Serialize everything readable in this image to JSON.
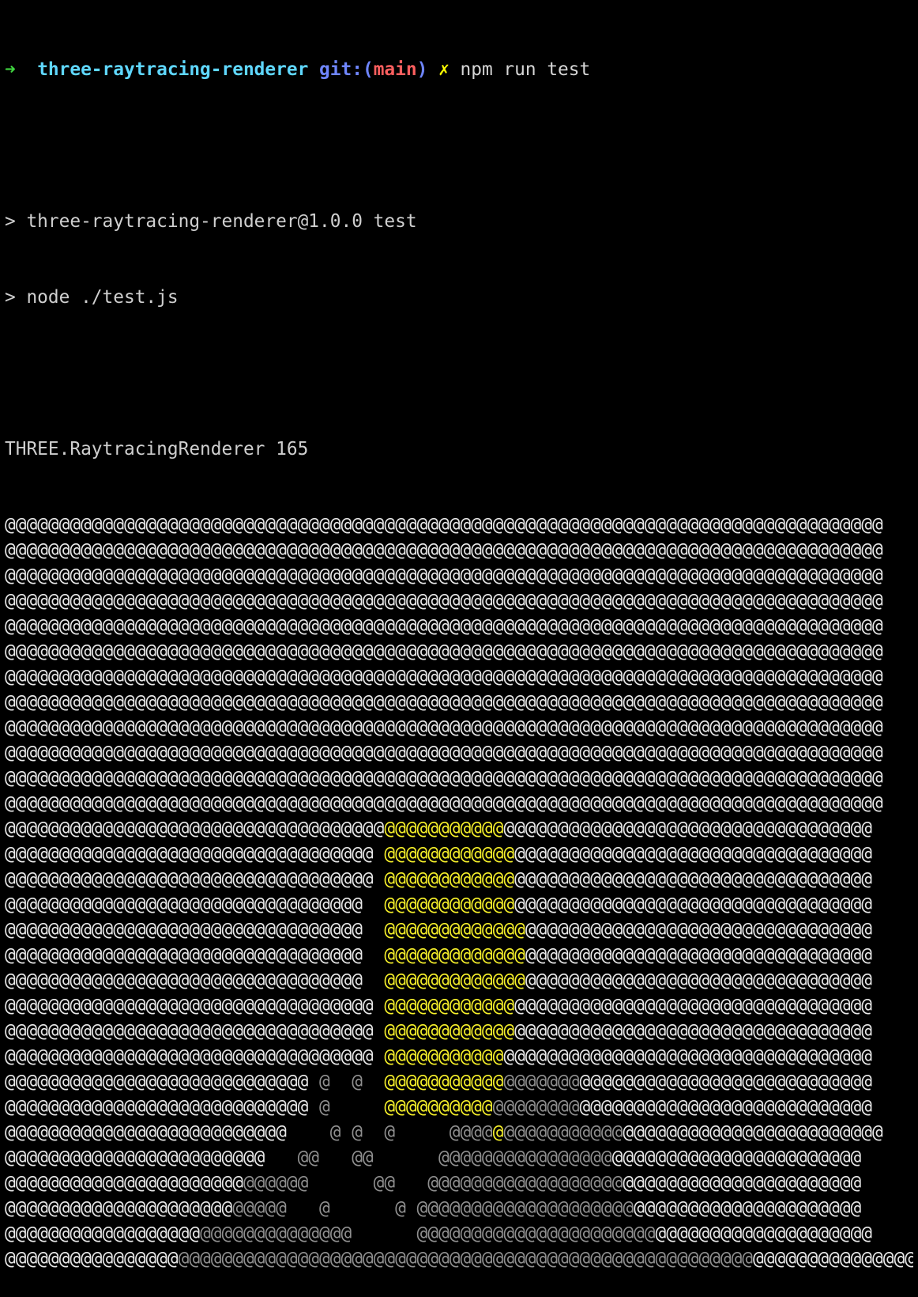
{
  "prompt": {
    "arrow": "➜",
    "dir": "three-raytracing-renderer",
    "git_prefix": "git:",
    "paren_open": "(",
    "branch": "main",
    "paren_close": ")",
    "dirty": "✗",
    "command": "npm run test"
  },
  "output": {
    "line1": "> three-raytracing-renderer@1.0.0 test",
    "line2": "> node ./test.js",
    "line3": "THREE.RaytracingRenderer 165"
  },
  "ascii_rows": [
    [
      [
        "w",
        "@@@@@@@@@@@@@@@@@@@@@@@@@@@@@@@@@@@@@@@@@@@@@@@@@@@@@@@@@@@@@@@@@@@@@@@@@@@@@@@@@"
      ]
    ],
    [
      [
        "w",
        "@@@@@@@@@@@@@@@@@@@@@@@@@@@@@@@@@@@@@@@@@@@@@@@@@@@@@@@@@@@@@@@@@@@@@@@@@@@@@@@@@"
      ]
    ],
    [
      [
        "w",
        "@@@@@@@@@@@@@@@@@@@@@@@@@@@@@@@@@@@@@@@@@@@@@@@@@@@@@@@@@@@@@@@@@@@@@@@@@@@@@@@@@"
      ]
    ],
    [
      [
        "w",
        "@@@@@@@@@@@@@@@@@@@@@@@@@@@@@@@@@@@@@@@@@@@@@@@@@@@@@@@@@@@@@@@@@@@@@@@@@@@@@@@@@"
      ]
    ],
    [
      [
        "w",
        "@@@@@@@@@@@@@@@@@@@@@@@@@@@@@@@@@@@@@@@@@@@@@@@@@@@@@@@@@@@@@@@@@@@@@@@@@@@@@@@@@"
      ]
    ],
    [
      [
        "w",
        "@@@@@@@@@@@@@@@@@@@@@@@@@@@@@@@@@@@@@@@@@@@@@@@@@@@@@@@@@@@@@@@@@@@@@@@@@@@@@@@@@"
      ]
    ],
    [
      [
        "w",
        "@@@@@@@@@@@@@@@@@@@@@@@@@@@@@@@@@@@@@@@@@@@@@@@@@@@@@@@@@@@@@@@@@@@@@@@@@@@@@@@@@"
      ]
    ],
    [
      [
        "w",
        "@@@@@@@@@@@@@@@@@@@@@@@@@@@@@@@@@@@@@@@@@@@@@@@@@@@@@@@@@@@@@@@@@@@@@@@@@@@@@@@@@"
      ]
    ],
    [
      [
        "w",
        "@@@@@@@@@@@@@@@@@@@@@@@@@@@@@@@@@@@@@@@@@@@@@@@@@@@@@@@@@@@@@@@@@@@@@@@@@@@@@@@@@"
      ]
    ],
    [
      [
        "w",
        "@@@@@@@@@@@@@@@@@@@@@@@@@@@@@@@@@@@@@@@@@@@@@@@@@@@@@@@@@@@@@@@@@@@@@@@@@@@@@@@@@"
      ]
    ],
    [
      [
        "w",
        "@@@@@@@@@@@@@@@@@@@@@@@@@@@@@@@@@@@@@@@@@@@@@@@@@@@@@@@@@@@@@@@@@@@@@@@@@@@@@@@@@"
      ]
    ],
    [
      [
        "w",
        "@@@@@@@@@@@@@@@@@@@@@@@@@@@@@@@@@@@@@@@@@@@@@@@@@@@@@@@@@@@@@@@@@@@@@@@@@@@@@@@@@"
      ]
    ],
    [
      [
        "w",
        "@@@@@@@@@@@@@@@@@@@@@@@@@@@@@@@@@@@"
      ],
      [
        "y",
        "@@@@@@@@@@@"
      ],
      [
        "w",
        "@@@@@@@@@@@@@@@@@@@@@@@@@@@@@@@@@@"
      ]
    ],
    [
      [
        "w",
        "@@@@@@@@@@@@@@@@@@@@@@@@@@@@@@@@@@ "
      ],
      [
        "y",
        "@@@@@@@@@@@@"
      ],
      [
        "w",
        "@@@@@@@@@@@@@@@@@@@@@@@@@@@@@@@@@"
      ]
    ],
    [
      [
        "w",
        "@@@@@@@@@@@@@@@@@@@@@@@@@@@@@@@@@@ "
      ],
      [
        "y",
        "@@@@@@@@@@@@"
      ],
      [
        "w",
        "@@@@@@@@@@@@@@@@@@@@@@@@@@@@@@@@@"
      ]
    ],
    [
      [
        "w",
        "@@@@@@@@@@@@@@@@@@@@@@@@@@@@@@@@@  "
      ],
      [
        "y",
        "@@@@@@@@@@@@"
      ],
      [
        "w",
        "@@@@@@@@@@@@@@@@@@@@@@@@@@@@@@@@@"
      ]
    ],
    [
      [
        "w",
        "@@@@@@@@@@@@@@@@@@@@@@@@@@@@@@@@@  "
      ],
      [
        "y",
        "@@@@@@@@@@@@@"
      ],
      [
        "w",
        "@@@@@@@@@@@@@@@@@@@@@@@@@@@@@@@@"
      ]
    ],
    [
      [
        "w",
        "@@@@@@@@@@@@@@@@@@@@@@@@@@@@@@@@@  "
      ],
      [
        "y",
        "@@@@@@@@@@@@@"
      ],
      [
        "w",
        "@@@@@@@@@@@@@@@@@@@@@@@@@@@@@@@@"
      ]
    ],
    [
      [
        "w",
        "@@@@@@@@@@@@@@@@@@@@@@@@@@@@@@@@@  "
      ],
      [
        "y",
        "@@@@@@@@@@@@@"
      ],
      [
        "w",
        "@@@@@@@@@@@@@@@@@@@@@@@@@@@@@@@@"
      ]
    ],
    [
      [
        "w",
        "@@@@@@@@@@@@@@@@@@@@@@@@@@@@@@@@@@ "
      ],
      [
        "y",
        "@@@@@@@@@@@@"
      ],
      [
        "w",
        "@@@@@@@@@@@@@@@@@@@@@@@@@@@@@@@@@"
      ]
    ],
    [
      [
        "w",
        "@@@@@@@@@@@@@@@@@@@@@@@@@@@@@@@@@@ "
      ],
      [
        "y",
        "@@@@@@@@@@@@"
      ],
      [
        "w",
        "@@@@@@@@@@@@@@@@@@@@@@@@@@@@@@@@@"
      ]
    ],
    [
      [
        "w",
        "@@@@@@@@@@@@@@@@@@@@@@@@@@@@@@@@@@ "
      ],
      [
        "y",
        "@@@@@@@@@@@"
      ],
      [
        "w",
        "@@@@@@@@@@@@@@@@@@@@@@@@@@@@@@@@@@"
      ]
    ],
    [
      [
        "w",
        "@@@@@@@@@@@@@@@@@@@@@@@@@@@@"
      ],
      [
        "g",
        " @  @  "
      ],
      [
        "y",
        "@@@@@@@@@@@"
      ],
      [
        "g",
        "@@@@@@@"
      ],
      [
        "w",
        "@@@@@@@@@@@@@@@@@@@@@@@@@@@"
      ]
    ],
    [
      [
        "w",
        "@@@@@@@@@@@@@@@@@@@@@@@@@@@@"
      ],
      [
        "g",
        " @     "
      ],
      [
        "y",
        "@@@@@@@@@@"
      ],
      [
        "g",
        "@@@@@@@@"
      ],
      [
        "w",
        "@@@@@@@@@@@@@@@@@@@@@@@@@@@"
      ]
    ],
    [
      [
        "w",
        "@@@@@@@@@@@@@@@@@@@@@@@@@@    "
      ],
      [
        "g",
        "@ @  @     @@@@"
      ],
      [
        "y",
        "@"
      ],
      [
        "g",
        "@@@@@@@@@@@"
      ],
      [
        "w",
        "@@@@@@@@@@@@@@@@@@@@@@@@"
      ]
    ],
    [
      [
        "w",
        "@@@@@@@@@@@@@@@@@@@@@@@@   "
      ],
      [
        "g",
        "@@   @@      @@@@@@@@@@@@@@@@"
      ],
      [
        "w",
        "@@@@@@@@@@@@@@@@@@@@@@@"
      ]
    ],
    [
      [
        "w",
        "@@@@@@@@@@@@@@@@@@@@@@"
      ],
      [
        "g",
        "@@@@@@      @@   @@@@@@@@@@@@@@@@@@"
      ],
      [
        "w",
        "@@@@@@@@@@@@@@@@@@@@@@"
      ]
    ],
    [
      [
        "w",
        "@@@@@@@@@@@@@@@@@@@@@"
      ],
      [
        "g",
        "@@@@@   @      @ @@@@@@@@@@@@@@@@@@@@"
      ],
      [
        "w",
        "@@@@@@@@@@@@@@@@@@@@@"
      ]
    ],
    [
      [
        "w",
        "@@@@@@@@@@@@@@@@@@"
      ],
      [
        "g",
        "@@@@@@@@@@@@@@      @@@@@@@@@@@@@@@@@@@@@@"
      ],
      [
        "w",
        "@@@@@@@@@@@@@@@@@@@@"
      ]
    ],
    [
      [
        "w",
        "@@@@@@@@@@@@@@@@"
      ],
      [
        "g",
        "@@@@@@@@@@@@@@@@@@@@@@@@@@@@@@@@@@@@@@@@@@@@@@@@@@@@@"
      ],
      [
        "w",
        "@@@@@@@@@@@@@@@"
      ]
    ]
  ]
}
